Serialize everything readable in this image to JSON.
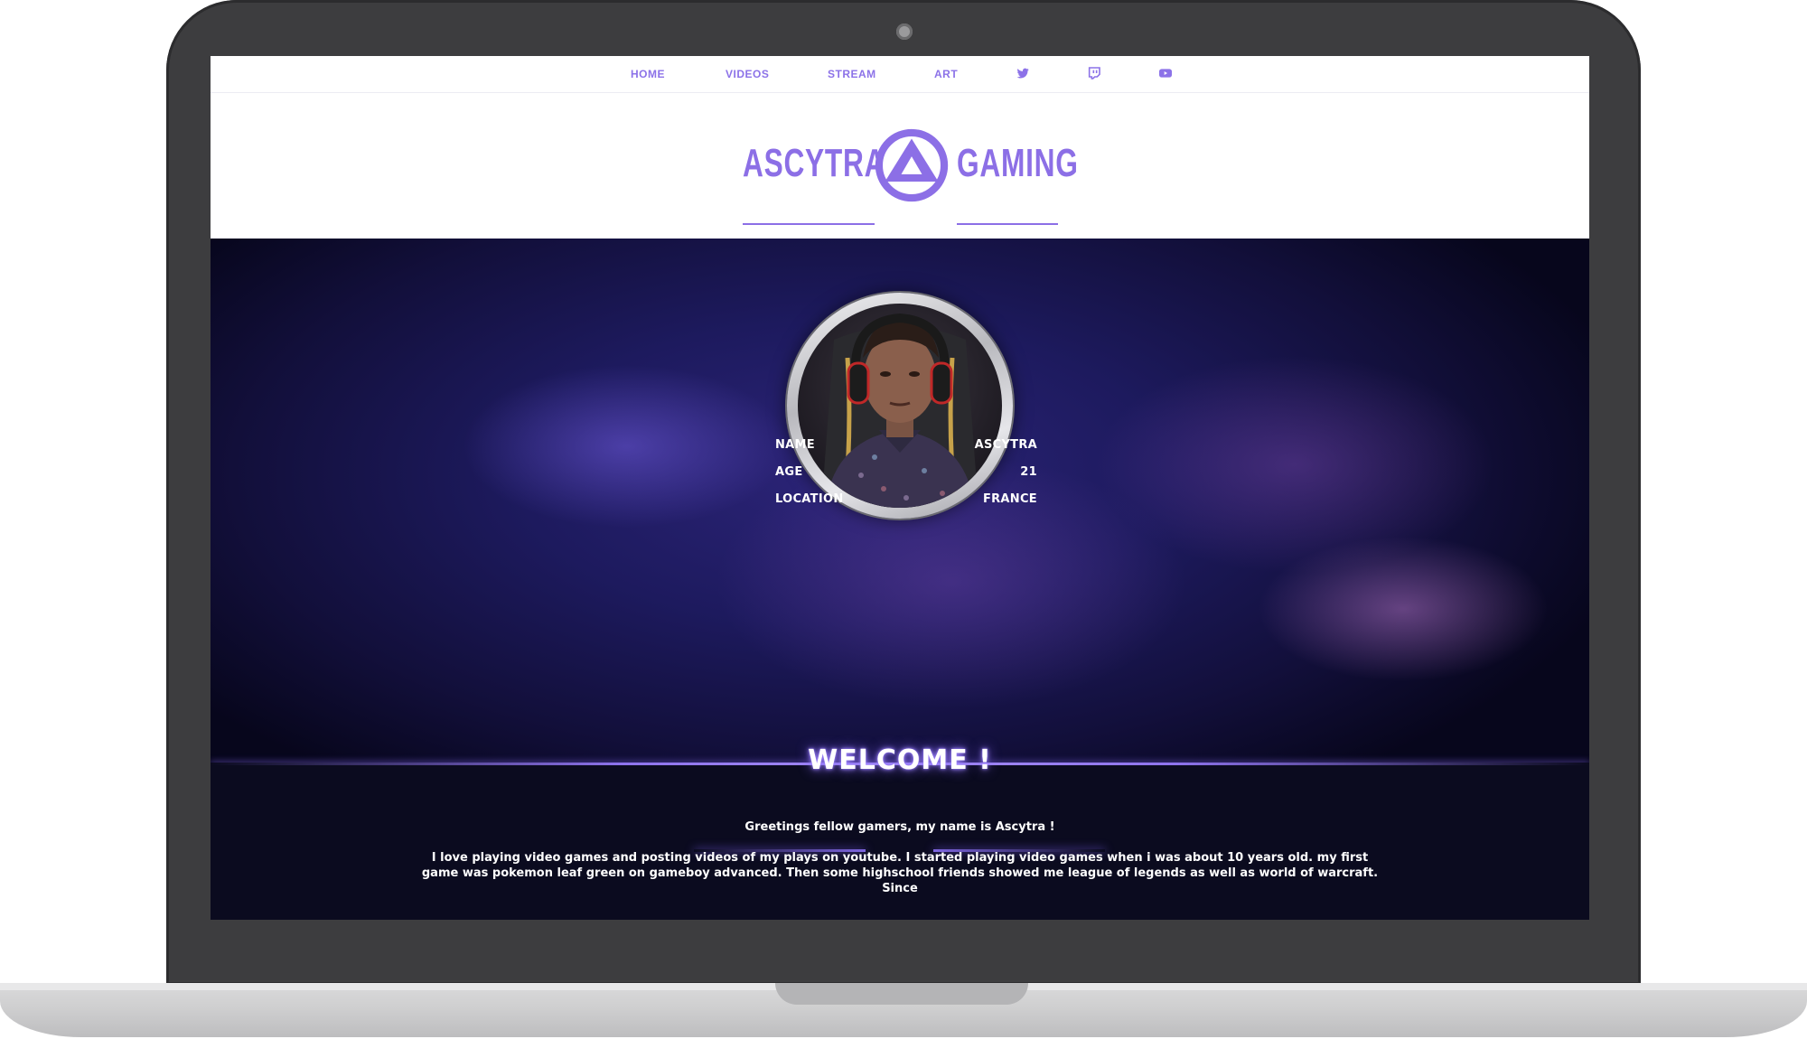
{
  "nav": {
    "items": [
      {
        "label": "HOME"
      },
      {
        "label": "VIDEOS"
      },
      {
        "label": "STREAM"
      },
      {
        "label": "ART"
      }
    ],
    "icons": [
      "twitter-icon",
      "twitch-icon",
      "youtube-icon"
    ]
  },
  "logo": {
    "left_word": "ASCYTRA",
    "right_word": "GAMING",
    "emblem": "triangle-circle-emblem"
  },
  "profile": {
    "avatar": "streamer-avatar",
    "rows": [
      {
        "label": "NAME",
        "value": "ASCYTRA"
      },
      {
        "label": "AGE",
        "value": "21"
      },
      {
        "label": "LOCATION",
        "value": "FRANCE"
      }
    ]
  },
  "welcome": {
    "title": "WELCOME !",
    "greeting": "Greetings fellow gamers, my name is Ascytra !",
    "body": "I love playing video games and posting videos of my plays on youtube. I started playing video games when i was about 10 years old. my first game was pokemon leaf green on gameboy advanced. Then some highschool friends showed me league of legends as well as world of warcraft. Since"
  },
  "colors": {
    "accent": "#8c6fe6",
    "frame": "#3d3d3f",
    "hero_dark": "#07061c",
    "section_bg": "#0b0b1f"
  }
}
